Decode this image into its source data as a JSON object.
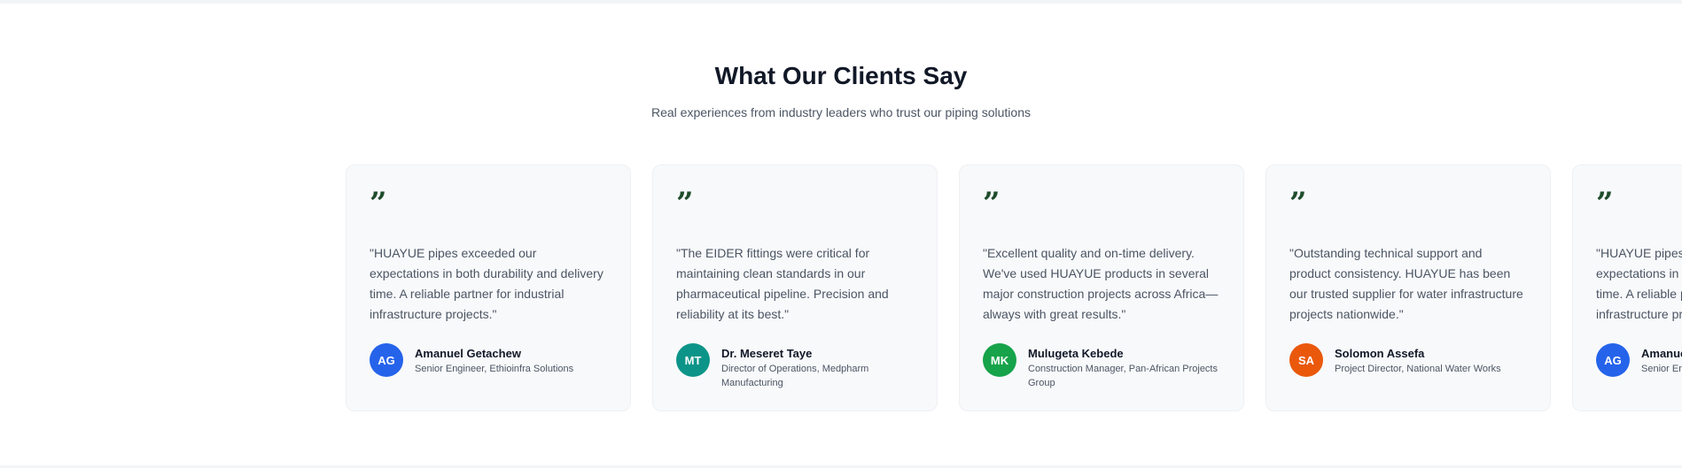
{
  "section": {
    "title": "What Our Clients Say",
    "subtitle": "Real experiences from industry leaders who trust our piping solutions"
  },
  "quote_glyph": "”",
  "testimonials": [
    {
      "text": "\"HUAYUE pipes exceeded our expectations in both durability and delivery time. A reliable partner for industrial infrastructure projects.\"",
      "initials": "AG",
      "name": "Amanuel Getachew",
      "role": "Senior Engineer, Ethioinfra Solutions",
      "avatar_color": "#2563eb"
    },
    {
      "text": "\"The EIDER fittings were critical for maintaining clean standards in our pharmaceutical pipeline. Precision and reliability at its best.\"",
      "initials": "MT",
      "name": "Dr. Meseret Taye",
      "role": "Director of Operations, Medpharm Manufacturing",
      "avatar_color": "#0d9488"
    },
    {
      "text": "\"Excellent quality and on-time delivery. We've used HUAYUE products in several major construction projects across Africa—always with great results.\"",
      "initials": "MK",
      "name": "Mulugeta Kebede",
      "role": "Construction Manager, Pan-African Projects Group",
      "avatar_color": "#16a34a"
    },
    {
      "text": "\"Outstanding technical support and product consistency. HUAYUE has been our trusted supplier for water infrastructure projects nationwide.\"",
      "initials": "SA",
      "name": "Solomon Assefa",
      "role": "Project Director, National Water Works",
      "avatar_color": "#ea580c"
    },
    {
      "text": "\"HUAYUE pipes exceeded our expectations in both durability and delivery time. A reliable partner for industrial infrastructure projects.\"",
      "initials": "AG",
      "name": "Amanuel Getachew",
      "role": "Senior Engineer, Ethioinfra Solutions",
      "avatar_color": "#2563eb"
    }
  ]
}
